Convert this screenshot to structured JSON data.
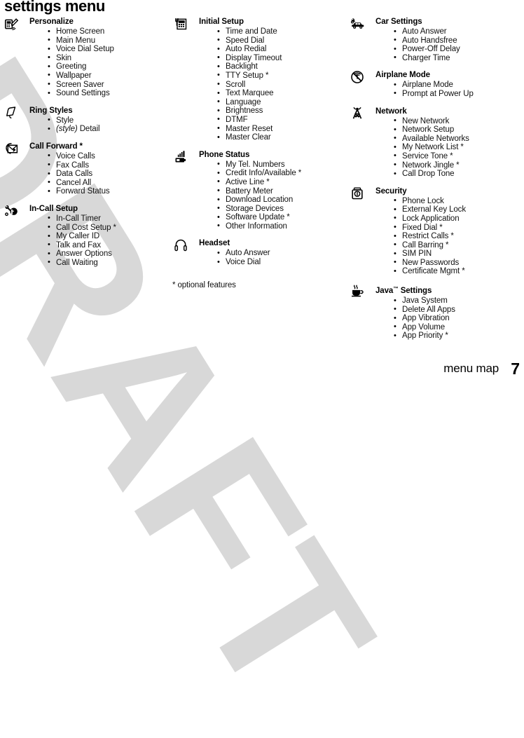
{
  "page": {
    "title": "settings menu",
    "footnote": "* optional features",
    "footer_label": "menu map",
    "footer_page_number": "7",
    "watermark": "DRAFT",
    "watermark_color": "#d8d8d8"
  },
  "columns": [
    {
      "id": "column-1",
      "groups": [
        {
          "icon": "personalize-pen-phone-icon",
          "title": "Personalize",
          "items": [
            "Home Screen",
            "Main Menu",
            "Voice Dial Setup",
            "Skin",
            "Greeting",
            "Wallpaper",
            "Screen Saver",
            "Sound Settings"
          ]
        },
        {
          "icon": "ring-styles-bell-icon",
          "title": "Ring Styles",
          "items": [
            "Style",
            "(style) Detail"
          ],
          "italic_items": [
            1
          ]
        },
        {
          "icon": "call-forward-envelope-arrow-icon",
          "title": "Call Forward *",
          "items": [
            "Voice Calls",
            "Fax Calls",
            "Data Calls",
            "Cancel All",
            "Forward Status"
          ]
        },
        {
          "icon": "in-call-setup-wrench-phone-icon",
          "title": "In-Call Setup",
          "items": [
            "In-Call Timer",
            "Call Cost Setup *",
            "My Caller ID",
            "Talk and Fax",
            "Answer Options",
            "Call Waiting"
          ]
        }
      ]
    },
    {
      "id": "column-2",
      "groups": [
        {
          "icon": "initial-setup-phone-tools-icon",
          "title": "Initial Setup",
          "items": [
            "Time and Date",
            "Speed Dial",
            "Auto Redial",
            "Display Timeout",
            "Backlight",
            "TTY Setup *",
            "Scroll",
            "Text Marquee",
            "Language",
            "Brightness",
            "DTMF",
            "Master Reset",
            "Master Clear"
          ]
        },
        {
          "icon": "phone-status-signal-battery-icon",
          "title": "Phone Status",
          "items": [
            "My Tel. Numbers",
            "Credit Info/Available *",
            "Active Line *",
            "Battery Meter",
            "Download Location",
            "Storage Devices",
            "Software Update *",
            "Other Information"
          ]
        },
        {
          "icon": "headset-headphones-icon",
          "title": "Headset",
          "items": [
            "Auto Answer",
            "Voice Dial"
          ]
        }
      ]
    },
    {
      "id": "column-3",
      "groups": [
        {
          "icon": "car-settings-car-icon",
          "title": "Car Settings",
          "items": [
            "Auto Answer",
            "Auto Handsfree",
            "Power-Off Delay",
            "Charger Time"
          ]
        },
        {
          "icon": "airplane-mode-no-signal-icon",
          "title": "Airplane Mode",
          "items": [
            "Airplane Mode",
            "Prompt at Power Up"
          ]
        },
        {
          "icon": "network-tower-icon",
          "title": "Network",
          "items": [
            "New Network",
            "Network Setup",
            "Available Networks",
            "My Network List *",
            "Service Tone *",
            "Network Jingle *",
            "Call Drop Tone"
          ]
        },
        {
          "icon": "security-padlock-icon",
          "title": "Security",
          "items": [
            "Phone Lock",
            "External Key Lock",
            "Lock Application",
            "Fixed Dial *",
            "Restrict Calls *",
            "Call Barring *",
            "SIM PIN",
            "New Passwords",
            "Certificate Mgmt *"
          ]
        },
        {
          "icon": "java-settings-coffee-cup-icon",
          "title": "Java™ Settings",
          "title_tm": true,
          "items": [
            "Java System",
            "Delete All Apps",
            "App Vibration",
            "App Volume",
            "App Priority *"
          ]
        }
      ]
    }
  ]
}
